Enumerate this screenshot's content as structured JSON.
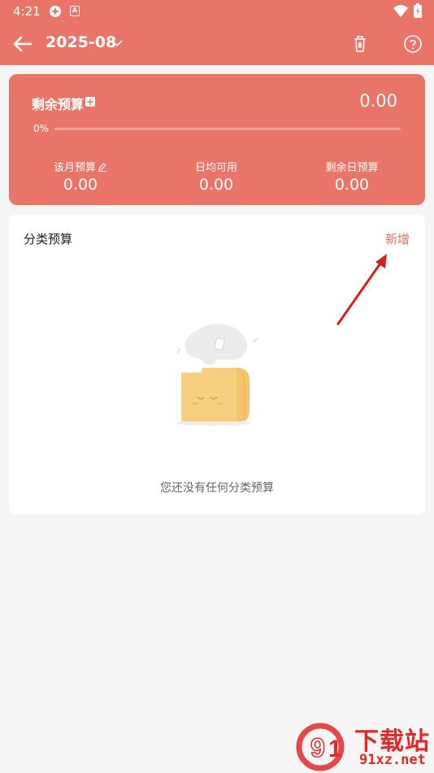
{
  "status_bar": {
    "time": "4:21",
    "badge": "A"
  },
  "toolbar": {
    "month": "2025-08"
  },
  "summary": {
    "remain_label": "剩余预算",
    "remain_value": "0.00",
    "percent": "0%",
    "progress": 0,
    "stats": [
      {
        "label": "该月预算",
        "value": "0.00"
      },
      {
        "label": "日均可用",
        "value": "0.00"
      },
      {
        "label": "剩余日预算",
        "value": "0.00"
      }
    ]
  },
  "category": {
    "title": "分类预算",
    "add_label": "新增",
    "empty_text": "您还没有任何分类预算"
  },
  "watermark": {
    "top_text": "下载站",
    "bottom_text": "91xz.net"
  },
  "colors": {
    "accent": "#e87567",
    "add_link": "#e8705f",
    "annotation": "#d41f1f"
  }
}
